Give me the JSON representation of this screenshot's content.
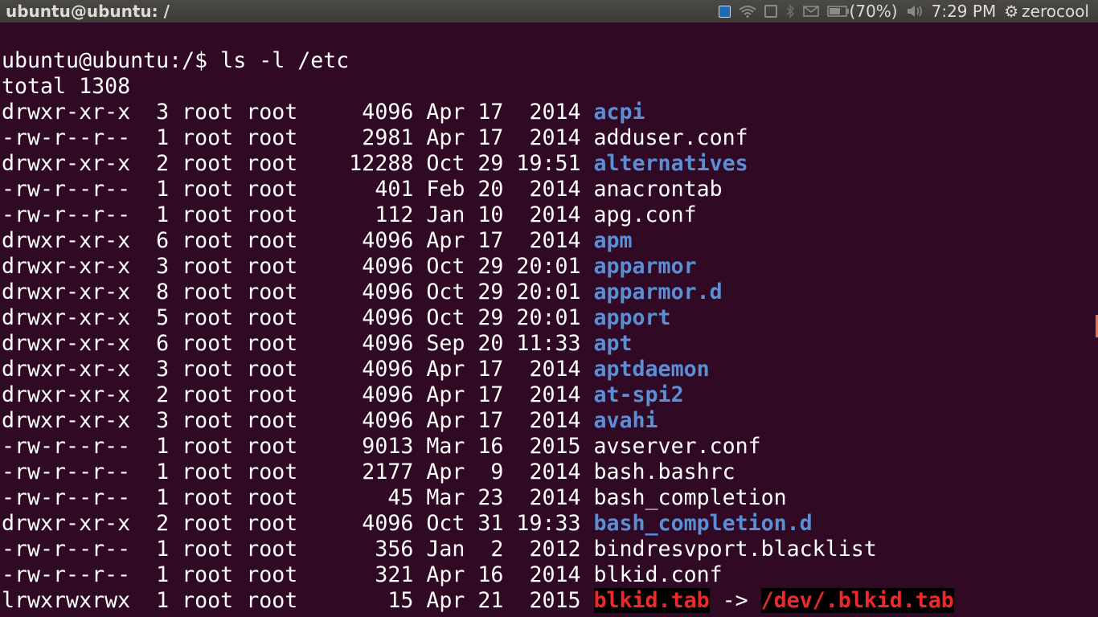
{
  "topbar": {
    "window_title": "ubuntu@ubuntu: /",
    "battery_label": "(70%)",
    "time": "7:29 PM",
    "user": "zerocool"
  },
  "terminal": {
    "command_line": "ubuntu@ubuntu:/$ ls -l /etc",
    "total_line": "total 1308",
    "rows": [
      {
        "prefix": "drwxr-xr-x  3 root root     4096 Apr 17  2014 ",
        "name": "acpi",
        "type": "dir"
      },
      {
        "prefix": "-rw-r--r--  1 root root     2981 Apr 17  2014 ",
        "name": "adduser.conf",
        "type": "file"
      },
      {
        "prefix": "drwxr-xr-x  2 root root    12288 Oct 29 19:51 ",
        "name": "alternatives",
        "type": "dir"
      },
      {
        "prefix": "-rw-r--r--  1 root root      401 Feb 20  2014 ",
        "name": "anacrontab",
        "type": "file"
      },
      {
        "prefix": "-rw-r--r--  1 root root      112 Jan 10  2014 ",
        "name": "apg.conf",
        "type": "file"
      },
      {
        "prefix": "drwxr-xr-x  6 root root     4096 Apr 17  2014 ",
        "name": "apm",
        "type": "dir"
      },
      {
        "prefix": "drwxr-xr-x  3 root root     4096 Oct 29 20:01 ",
        "name": "apparmor",
        "type": "dir"
      },
      {
        "prefix": "drwxr-xr-x  8 root root     4096 Oct 29 20:01 ",
        "name": "apparmor.d",
        "type": "dir"
      },
      {
        "prefix": "drwxr-xr-x  5 root root     4096 Oct 29 20:01 ",
        "name": "apport",
        "type": "dir"
      },
      {
        "prefix": "drwxr-xr-x  6 root root     4096 Sep 20 11:33 ",
        "name": "apt",
        "type": "dir"
      },
      {
        "prefix": "drwxr-xr-x  3 root root     4096 Apr 17  2014 ",
        "name": "aptdaemon",
        "type": "dir"
      },
      {
        "prefix": "drwxr-xr-x  2 root root     4096 Apr 17  2014 ",
        "name": "at-spi2",
        "type": "dir"
      },
      {
        "prefix": "drwxr-xr-x  3 root root     4096 Apr 17  2014 ",
        "name": "avahi",
        "type": "dir"
      },
      {
        "prefix": "-rw-r--r--  1 root root     9013 Mar 16  2015 ",
        "name": "avserver.conf",
        "type": "file"
      },
      {
        "prefix": "-rw-r--r--  1 root root     2177 Apr  9  2014 ",
        "name": "bash.bashrc",
        "type": "file"
      },
      {
        "prefix": "-rw-r--r--  1 root root       45 Mar 23  2014 ",
        "name": "bash_completion",
        "type": "file"
      },
      {
        "prefix": "drwxr-xr-x  2 root root     4096 Oct 31 19:33 ",
        "name": "bash_completion.d",
        "type": "dir"
      },
      {
        "prefix": "-rw-r--r--  1 root root      356 Jan  2  2012 ",
        "name": "bindresvport.blacklist",
        "type": "file"
      },
      {
        "prefix": "-rw-r--r--  1 root root      321 Apr 16  2014 ",
        "name": "blkid.conf",
        "type": "file"
      },
      {
        "prefix": "lrwxrwxrwx  1 root root       15 Apr 21  2015 ",
        "name": "blkid.tab",
        "type": "link",
        "arrow": " -> ",
        "target": "/dev/.blkid.tab"
      }
    ]
  },
  "colors": {
    "terminal_bg": "#300a24",
    "directory": "#5a8ed7",
    "broken_link": "#ef2929",
    "topbar_bg": "#3c3b37"
  }
}
